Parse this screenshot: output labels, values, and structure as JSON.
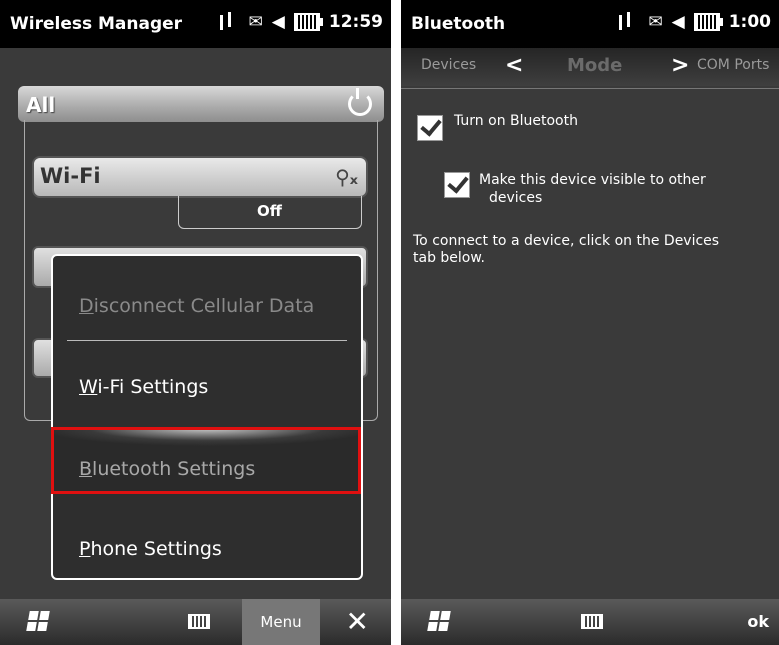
{
  "left_screen": {
    "status_title": "Wireless Manager",
    "time": "12:59",
    "all_label": "All",
    "wifi_label": "Wi-Fi",
    "wifi_status": "Off",
    "menu_items": [
      {
        "label": "Disconnect Cellular Data",
        "mnemonic": "D",
        "rest": "isconnect Cellular Data",
        "enabled": false
      },
      {
        "label": "Wi-Fi Settings",
        "mnemonic": "W",
        "rest": "i-Fi Settings",
        "enabled": true
      },
      {
        "label": "Bluetooth Settings",
        "mnemonic": "B",
        "rest": "luetooth Settings",
        "enabled": true,
        "selected": true
      },
      {
        "label": "Phone Settings",
        "mnemonic": "P",
        "rest": "hone Settings",
        "enabled": true
      }
    ],
    "softkey_menu": "Menu",
    "icons": [
      "data-connection-icon",
      "message-icon",
      "speaker-icon",
      "battery-icon",
      "power-icon",
      "wifi-antenna-icon",
      "windows-start-icon",
      "keyboard-icon",
      "close-icon"
    ]
  },
  "right_screen": {
    "status_title": "Bluetooth",
    "time": "1:00",
    "tabs": {
      "left": "Devices",
      "center": "Mode",
      "right": "COM Ports"
    },
    "turn_on_label": "Turn on Bluetooth",
    "turn_on_checked": true,
    "visible_label_line1": "Make this device visible to other",
    "visible_label_line2": "devices",
    "visible_checked": true,
    "info_line1": "To connect to a device, click on the Devices",
    "info_line2": "tab below.",
    "softkey_ok": "ok"
  },
  "colors": {
    "highlight_border": "#e01010",
    "background": "#3a3a3a"
  }
}
